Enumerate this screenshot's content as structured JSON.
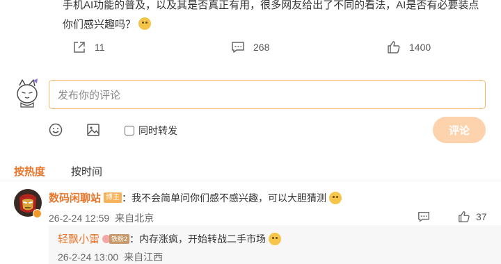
{
  "post": {
    "text_cut": "手机AI功能的普及，以及其是否真正有用，很多网友给出了不同的看法，AI是否有必要装点",
    "text_last": "你们感兴趣吗？"
  },
  "actions": {
    "share_count": "11",
    "comment_count": "268",
    "like_count": "1400"
  },
  "composer": {
    "placeholder": "发布你的评论",
    "repost_label": "同时转发",
    "submit_label": "评论"
  },
  "sort": {
    "hot_label": "按热度",
    "time_label": "按时间"
  },
  "comment": {
    "username": "数码闲聊站",
    "tag": "博主",
    "text": "：我不会简单问你们感不感兴趣，可以大胆猜测",
    "time": "26-2-24 12:59",
    "location": "来自北京",
    "likes": "37"
  },
  "reply": {
    "username": "轻飘小雷",
    "fan_level": "铁粉2",
    "text": "：内存涨疯，开始转战二手市场",
    "time": "26-2-24 13:00",
    "location": "来自江西"
  },
  "colors": {
    "accent": "#e8772e",
    "submit_bg": "#fdd3ae",
    "input_border": "#f4b76a"
  }
}
